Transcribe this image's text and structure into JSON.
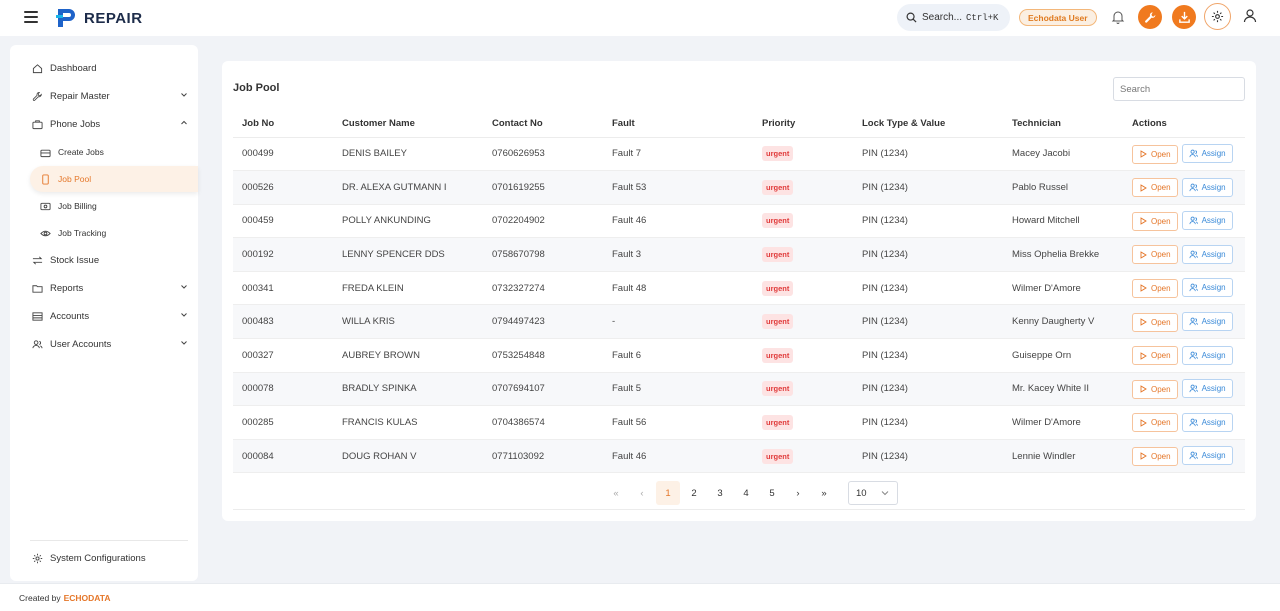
{
  "header": {
    "brand": "REPAIR",
    "search_label": "Search...",
    "search_shortcut": "Ctrl+K",
    "user_badge": "Echodata User"
  },
  "sidebar": {
    "items": [
      {
        "label": "Dashboard",
        "icon": "home-icon"
      },
      {
        "label": "Repair Master",
        "icon": "wrench-icon"
      },
      {
        "label": "Phone Jobs",
        "icon": "briefcase-icon"
      },
      {
        "label": "Create Jobs",
        "icon": "create-jobs-icon"
      },
      {
        "label": "Job Pool",
        "icon": "phone-icon"
      },
      {
        "label": "Job Billing",
        "icon": "billing-icon"
      },
      {
        "label": "Job Tracking",
        "icon": "eye-icon"
      },
      {
        "label": "Stock Issue",
        "icon": "transfer-icon"
      },
      {
        "label": "Reports",
        "icon": "folder-icon"
      },
      {
        "label": "Accounts",
        "icon": "list-icon"
      },
      {
        "label": "User Accounts",
        "icon": "users-icon"
      }
    ],
    "system": "System Configurations"
  },
  "main": {
    "title": "Job Pool",
    "search_placeholder": "Search",
    "columns": [
      "Job No",
      "Customer Name",
      "Contact No",
      "Fault",
      "Priority",
      "Lock Type & Value",
      "Technician",
      "Actions"
    ],
    "open_label": "Open",
    "assign_label": "Assign",
    "rows": [
      {
        "job": "000499",
        "customer": "DENIS BAILEY",
        "contact": "0760626953",
        "fault": "Fault 7",
        "priority": "urgent",
        "lock": "PIN (1234)",
        "tech": "Macey Jacobi"
      },
      {
        "job": "000526",
        "customer": "DR. ALEXA GUTMANN I",
        "contact": "0701619255",
        "fault": "Fault 53",
        "priority": "urgent",
        "lock": "PIN (1234)",
        "tech": "Pablo Russel"
      },
      {
        "job": "000459",
        "customer": "POLLY ANKUNDING",
        "contact": "0702204902",
        "fault": "Fault 46",
        "priority": "urgent",
        "lock": "PIN (1234)",
        "tech": "Howard Mitchell"
      },
      {
        "job": "000192",
        "customer": "LENNY SPENCER DDS",
        "contact": "0758670798",
        "fault": "Fault 3",
        "priority": "urgent",
        "lock": "PIN (1234)",
        "tech": "Miss Ophelia Brekke"
      },
      {
        "job": "000341",
        "customer": "FREDA KLEIN",
        "contact": "0732327274",
        "fault": "Fault 48",
        "priority": "urgent",
        "lock": "PIN (1234)",
        "tech": "Wilmer D'Amore"
      },
      {
        "job": "000483",
        "customer": "WILLA KRIS",
        "contact": "0794497423",
        "fault": "-",
        "priority": "urgent",
        "lock": "PIN (1234)",
        "tech": "Kenny Daugherty V"
      },
      {
        "job": "000327",
        "customer": "AUBREY BROWN",
        "contact": "0753254848",
        "fault": "Fault 6",
        "priority": "urgent",
        "lock": "PIN (1234)",
        "tech": "Guiseppe Orn"
      },
      {
        "job": "000078",
        "customer": "BRADLY SPINKA",
        "contact": "0707694107",
        "fault": "Fault 5",
        "priority": "urgent",
        "lock": "PIN (1234)",
        "tech": "Mr. Kacey White II"
      },
      {
        "job": "000285",
        "customer": "FRANCIS KULAS",
        "contact": "0704386574",
        "fault": "Fault 56",
        "priority": "urgent",
        "lock": "PIN (1234)",
        "tech": "Wilmer D'Amore"
      },
      {
        "job": "000084",
        "customer": "DOUG ROHAN V",
        "contact": "0771103092",
        "fault": "Fault 46",
        "priority": "urgent",
        "lock": "PIN (1234)",
        "tech": "Lennie Windler"
      }
    ]
  },
  "pagination": {
    "first": "«",
    "prev": "‹",
    "pages": [
      "1",
      "2",
      "3",
      "4",
      "5"
    ],
    "current_page": "1",
    "next": "›",
    "last": "»",
    "page_size": "10"
  },
  "footer": {
    "prefix": "Created by",
    "brand": "ECHODATA"
  },
  "colors": {
    "accent": "#f07a1f",
    "urgent_bg": "#fde3e3",
    "urgent_text": "#e03a3a",
    "assign_blue": "#3a8ad8"
  }
}
